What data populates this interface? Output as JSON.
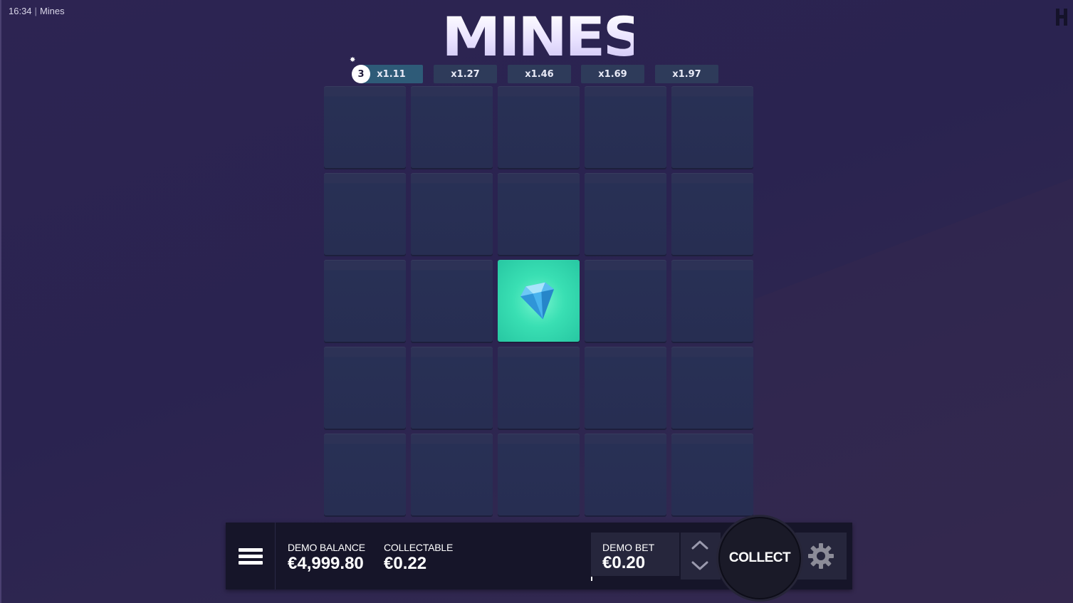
{
  "status_bar": {
    "time": "16:34",
    "separator": "|",
    "app_name": "Mines"
  },
  "game_title": "MINES",
  "mines_count": "3",
  "multipliers": [
    "x1.11",
    "x1.27",
    "x1.46",
    "x1.69",
    "x1.97"
  ],
  "active_multiplier_index": 0,
  "grid": {
    "rows": 5,
    "cols": 5,
    "revealed": [
      {
        "row": 2,
        "col": 2,
        "content": "gem"
      }
    ]
  },
  "bottom_bar": {
    "balance_label": "DEMO BALANCE",
    "balance_value": "€4,999.80",
    "collectable_label": "COLLECTABLE",
    "collectable_value": "€0.22",
    "bet_label": "DEMO BET",
    "bet_value": "€0.20",
    "collect_label": "COLLECT"
  },
  "colors": {
    "background": "#2d2452",
    "tile": "#272e52",
    "gem_tile": "#39dfb3",
    "multiplier_active": "#2e5b78",
    "multiplier": "#2e3b5a",
    "bar": "#161529"
  },
  "icons": [
    "menu-icon",
    "chevron-up-icon",
    "chevron-down-icon",
    "gear-icon",
    "bomb-icon",
    "diamond-icon",
    "provider-logo-icon"
  ]
}
